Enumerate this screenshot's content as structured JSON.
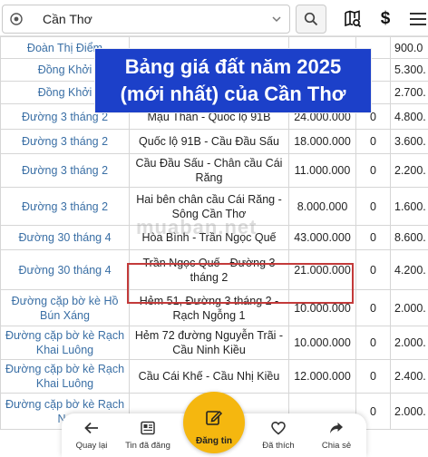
{
  "topbar": {
    "location": "Cần Thơ"
  },
  "banner": {
    "line1": "Bảng giá đất năm 2025",
    "line2": "(mới nhất) của Cần Thơ"
  },
  "watermark": "muaban.net",
  "table": {
    "rows": [
      {
        "road": "Đoàn Thị Điểm",
        "segment": "",
        "price": "",
        "col4": "",
        "col5": "900.0"
      },
      {
        "road": "Đồng Khởi",
        "segment": "",
        "price": "",
        "col4": "",
        "col5": "5.300."
      },
      {
        "road": "Đồng Khởi",
        "segment": "",
        "price": "",
        "col4": "",
        "col5": "2.700."
      },
      {
        "road": "Đường 3 tháng 2",
        "segment": "Mậu Thân - Quốc lộ 91B",
        "price": "24.000.000",
        "col4": "0",
        "col5": "4.800."
      },
      {
        "road": "Đường 3 tháng 2",
        "segment": "Quốc lộ 91B - Cầu Đầu Sấu",
        "price": "18.000.000",
        "col4": "0",
        "col5": "3.600."
      },
      {
        "road": "Đường 3 tháng 2",
        "segment": "Cầu Đầu Sấu - Chân cầu Cái Răng",
        "price": "11.000.000",
        "col4": "0",
        "col5": "2.200."
      },
      {
        "road": "Đường 3 tháng 2",
        "segment": "Hai bên chân cầu Cái Răng - Sông Cần Thơ",
        "price": "8.000.000",
        "col4": "0",
        "col5": "1.600."
      },
      {
        "road": "Đường 30 tháng 4",
        "segment": "Hòa Bình - Trần Ngọc Quế",
        "price": "43.000.000",
        "col4": "0",
        "col5": "8.600."
      },
      {
        "road": "Đường 30 tháng 4",
        "segment": "Trần Ngọc Quế - Đường 3 tháng 2",
        "price": "21.000.000",
        "col4": "0",
        "col5": "4.200."
      },
      {
        "road": "Đường cặp bờ kè Hồ Bún Xáng",
        "segment": "Hẻm 51, Đường 3 tháng 2 - Rạch Ngỗng 1",
        "price": "10.000.000",
        "col4": "0",
        "col5": "2.000."
      },
      {
        "road": "Đường cặp bờ kè Rạch Khai Luông",
        "segment": "Hẻm 72 đường Nguyễn Trãi - Cầu Ninh Kiều",
        "price": "10.000.000",
        "col4": "0",
        "col5": "2.000."
      },
      {
        "road": "Đường cặp bờ kè Rạch Khai Luông",
        "segment": "Cầu Cái Khế - Cầu Nhị Kiều",
        "price": "12.000.000",
        "col4": "0",
        "col5": "2.400."
      },
      {
        "road": "Đường cặp bờ kè Rạch Ng",
        "segment": "",
        "price": "",
        "col4": "0",
        "col5": "2.000."
      }
    ]
  },
  "bottomnav": {
    "back": "Quay lại",
    "posted": "Tin đã đăng",
    "post": "Đăng tin",
    "liked": "Đã thích",
    "share": "Chia sẻ"
  },
  "colors": {
    "banner": "#1c40c9",
    "highlight": "#c33a3a",
    "fab": "#f5b70f",
    "road_link": "#3a6fa5"
  }
}
